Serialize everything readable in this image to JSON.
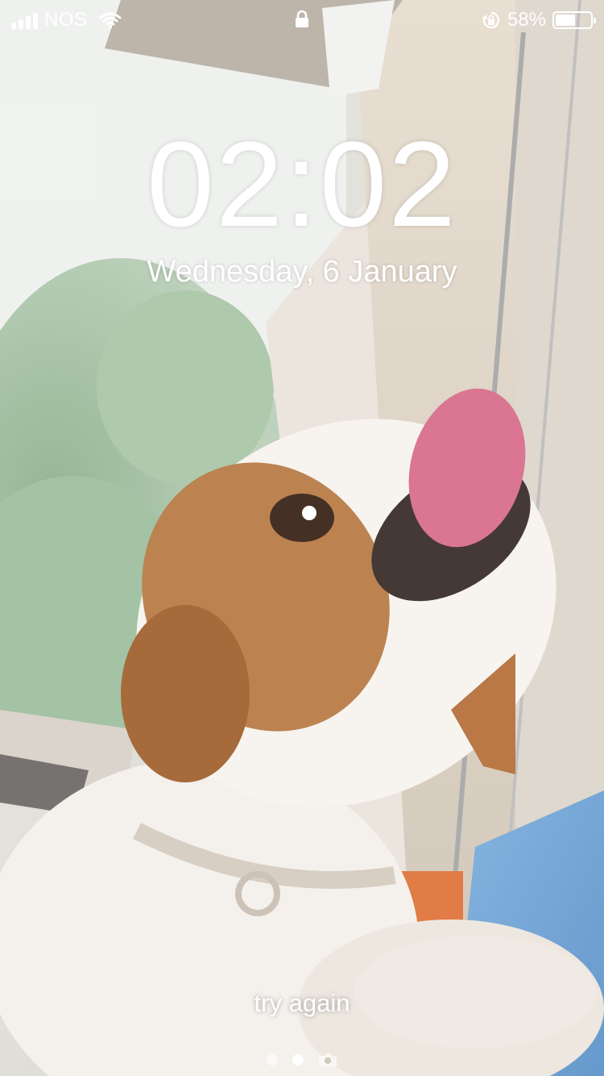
{
  "status_bar": {
    "carrier": "NOS",
    "battery_percent": "58%",
    "battery_level": 0.58,
    "signal_bars": 4,
    "icons": [
      "signal-icon",
      "wifi-icon",
      "lock-icon",
      "rotation-lock-icon",
      "battery-icon"
    ]
  },
  "lock_screen": {
    "time": "02:02",
    "date": "Wednesday, 6 January",
    "message": "try again"
  },
  "page_indicator": {
    "pages": 2,
    "active_index": 1,
    "extra_icon": "camera-icon"
  },
  "colors": {
    "text": "#ffffff"
  }
}
